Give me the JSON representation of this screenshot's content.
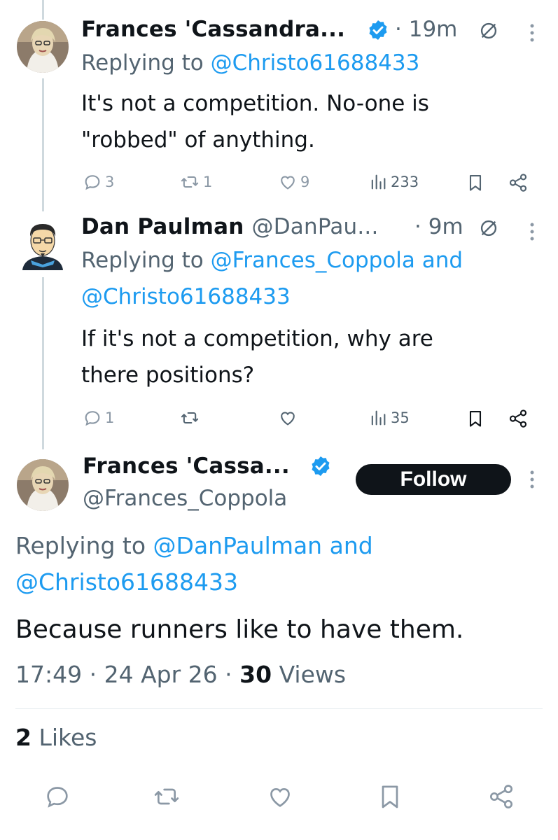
{
  "tweets": [
    {
      "display_name": "Frances 'Cassandra...",
      "handle": "",
      "time": "19m",
      "replying_prefix": "Replying to ",
      "replying_links": "@Christo61688433",
      "replying_links_2": "",
      "text_line1": "It's not a competition. No-one is",
      "text_line2": "\"robbed\" of anything.",
      "replies": "3",
      "reposts": "1",
      "likes": "9",
      "views": "233"
    },
    {
      "display_name": "Dan Paulman",
      "handle": "@DanPau...",
      "time": "9m",
      "replying_prefix": "Replying to ",
      "replying_links": "@Frances_Coppola and",
      "replying_links_2": "@Christo61688433",
      "text_line1": "If it's not a competition, why are",
      "text_line2": "there positions?",
      "replies": "1",
      "reposts": "",
      "likes": "",
      "views": "35"
    }
  ],
  "main_tweet": {
    "display_name": "Frances 'Cassa...",
    "handle": "@Frances_Coppola",
    "follow_label": "Follow",
    "replying_prefix": "Replying to ",
    "replying_links": "@DanPaulman and",
    "replying_links_2": "@Christo61688433",
    "text": "Because runners like to have them.",
    "time": "17:49",
    "date": "24 Apr 26",
    "views_count": "30",
    "views_label": "Views",
    "likes_count": "2",
    "likes_label": "Likes"
  },
  "icons": [
    "verified-badge-icon",
    "no-reply-icon",
    "more-options-icon",
    "reply-icon",
    "repost-icon",
    "like-icon",
    "views-icon",
    "bookmark-icon",
    "share-icon"
  ],
  "colors": {
    "link": "#1d9bf0",
    "secondary_text": "#536471",
    "action_gray": "#8b98a5",
    "follow_bg": "#0f1419"
  }
}
